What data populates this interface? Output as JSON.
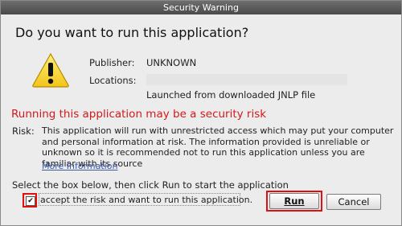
{
  "window": {
    "title": "Security Warning"
  },
  "dialog": {
    "question": "Do you want to run this application?",
    "icon": "warning-triangle-icon",
    "publisher_label": "Publisher:",
    "publisher_value": "UNKNOWN",
    "locations_label": "Locations:",
    "locations_value": "",
    "launch_note": "Launched from downloaded JNLP file"
  },
  "risk": {
    "title": "Running this application may be a security risk",
    "label": "Risk:",
    "text": "This application will run with unrestricted access which may put your computer and personal information at risk. The information provided is unreliable or unknown so it is recommended not to run this application unless you are familiar with its source",
    "more_info": "More Information"
  },
  "instruction": "Select the box below, then click Run to start the application",
  "checkbox": {
    "label": "accept the risk and want to run this application.",
    "checked": true,
    "mark": "✔"
  },
  "buttons": {
    "run": "Run",
    "cancel": "Cancel"
  },
  "colors": {
    "risk_title": "#d11a1a",
    "highlight_frame": "#e01010",
    "link": "#3b5aa8"
  }
}
